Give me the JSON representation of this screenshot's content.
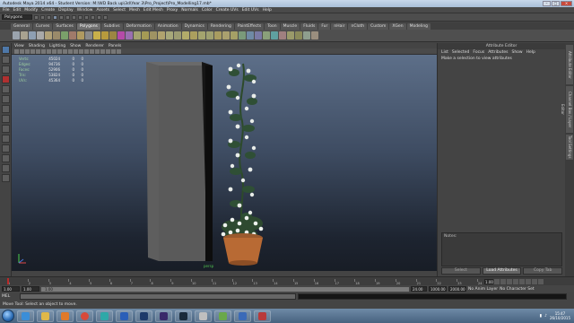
{
  "window": {
    "title": "Autodesk Maya 2014 x64 - Student Version: M:\\WD Back up\\3d\\Year 3\\Pro_Project\\Pro_Modelling17.mb*",
    "controls": [
      "minimize",
      "maximize",
      "close"
    ]
  },
  "menubar": [
    "File",
    "Edit",
    "Modify",
    "Create",
    "Display",
    "Window",
    "Assets",
    "Select",
    "Mesh",
    "Edit Mesh",
    "Proxy",
    "Normals",
    "Color",
    "Create UVs",
    "Edit UVs",
    "Help"
  ],
  "statusline": {
    "mode": "Polygons"
  },
  "shelf_tabs": {
    "items": [
      "General",
      "Curves",
      "Surfaces",
      "Polygons",
      "Subdivs",
      "Deformation",
      "Animation",
      "Dynamics",
      "Rendering",
      "PaintEffects",
      "Toon",
      "Muscle",
      "Fluids",
      "Fur",
      "nHair",
      "nCloth",
      "Custom",
      "XGen",
      "Modeling"
    ],
    "active": "Polygons"
  },
  "viewport": {
    "menu": [
      "View",
      "Shading",
      "Lighting",
      "Show",
      "Renderer",
      "Panels"
    ],
    "hud": [
      {
        "label": "Verts:",
        "value": "45024",
        "c2": "0",
        "c3": "0"
      },
      {
        "label": "Edges:",
        "value": "94736",
        "c2": "0",
        "c3": "0"
      },
      {
        "label": "Faces:",
        "value": "52906",
        "c2": "0",
        "c3": "0"
      },
      {
        "label": "Tris:",
        "value": "53824",
        "c2": "0",
        "c3": "0"
      },
      {
        "label": "UVs:",
        "value": "45364",
        "c2": "0",
        "c3": "0"
      }
    ],
    "camera_label": "persp"
  },
  "attribute_editor": {
    "title": "Attribute Editor",
    "menu": [
      "List",
      "Selected",
      "Focus",
      "Attributes",
      "Show",
      "Help"
    ],
    "message": "Make a selection to view attributes",
    "notes_label": "Notes:",
    "buttons": [
      "Select",
      "Load Attributes",
      "Copy Tab"
    ]
  },
  "side_tabs": [
    "Attribute Editor",
    "Channel Box / Layer Editor",
    "Tool Settings"
  ],
  "time_slider": {
    "ticks": [
      "1",
      "2",
      "3",
      "4",
      "5",
      "6",
      "7",
      "8",
      "9",
      "10",
      "11",
      "12",
      "13",
      "14",
      "15",
      "16",
      "17",
      "18",
      "19",
      "20",
      "21",
      "22",
      "23",
      "24"
    ],
    "current_frame": "1.00"
  },
  "range_slider": {
    "start": "1.00",
    "start_inner": "1.00",
    "bar_label": "1.00",
    "end_inner": "24.00",
    "end": "1000.00",
    "end2": "2000.00",
    "anim_layer": "No Anim Layer",
    "character_set": "No Character Set"
  },
  "command_line": {
    "label": "MEL"
  },
  "help_line": {
    "text": "Move Tool: Select an object to move."
  },
  "taskbar": {
    "apps": [
      "ie",
      "explorer",
      "media",
      "chrome",
      "maya",
      "word",
      "photoshop",
      "premiere",
      "steam",
      "app10",
      "app11",
      "app12",
      "app13"
    ],
    "clock": {
      "time": "15:47",
      "date": "26/10/2015"
    }
  },
  "colors": {
    "viewport_top": "#5d6f89",
    "viewport_bottom": "#181d26",
    "accent": "#4e78a8",
    "timeline_marker": "#b82a2a"
  }
}
